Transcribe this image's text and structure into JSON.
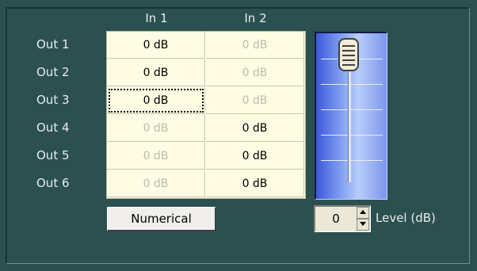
{
  "columns": [
    "In 1",
    "In 2"
  ],
  "rows": [
    {
      "label": "Out 1",
      "cells": [
        "0 dB",
        "0 dB"
      ],
      "active": [
        true,
        false
      ]
    },
    {
      "label": "Out 2",
      "cells": [
        "0 dB",
        "0 dB"
      ],
      "active": [
        true,
        false
      ]
    },
    {
      "label": "Out 3",
      "cells": [
        "0 dB",
        "0 dB"
      ],
      "active": [
        true,
        false
      ]
    },
    {
      "label": "Out 4",
      "cells": [
        "0 dB",
        "0 dB"
      ],
      "active": [
        false,
        true
      ]
    },
    {
      "label": "Out 5",
      "cells": [
        "0 dB",
        "0 dB"
      ],
      "active": [
        false,
        true
      ]
    },
    {
      "label": "Out 6",
      "cells": [
        "0 dB",
        "0 dB"
      ],
      "active": [
        false,
        true
      ]
    }
  ],
  "focused_cell": {
    "row": 2,
    "col": 0
  },
  "numerical_button": "Numerical",
  "level": {
    "value": "0",
    "label": "Level (dB)"
  },
  "fader": {
    "level_fraction": 1.0
  },
  "colors": {
    "background": "#2c5050",
    "grid": "#fefce2",
    "inactive_text": "#bcbcb0",
    "fader_blue": "#6e8ef0"
  }
}
